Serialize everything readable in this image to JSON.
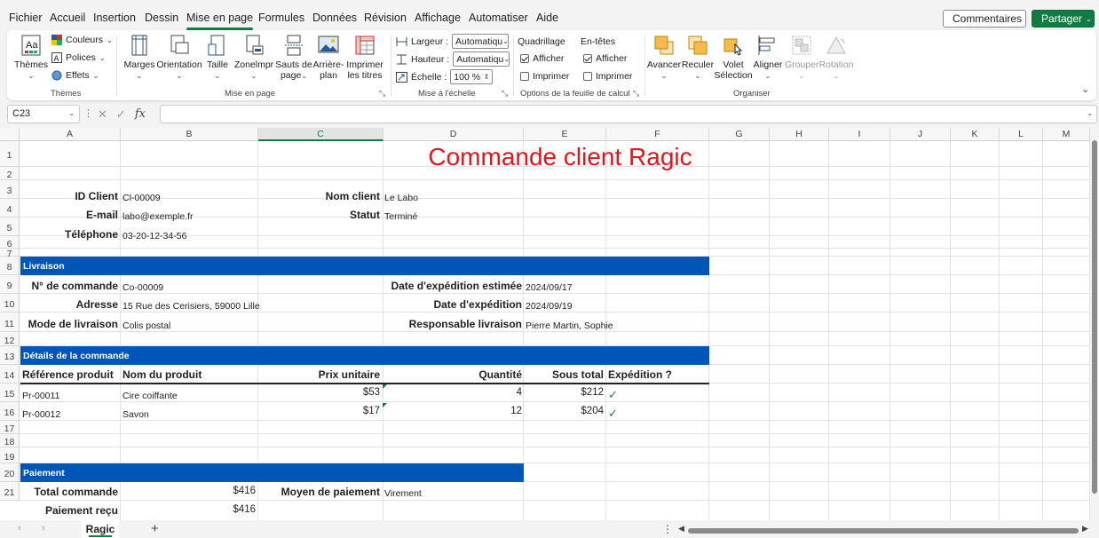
{
  "menu": {
    "tabs": [
      "Fichier",
      "Accueil",
      "Insertion",
      "Dessin",
      "Mise en page",
      "Formules",
      "Données",
      "Révision",
      "Affichage",
      "Automatiser",
      "Aide"
    ],
    "active_tab": "Mise en page",
    "comments_label": "Commentaires",
    "share_label": "Partager"
  },
  "ribbon": {
    "themes": {
      "themes": "Thèmes",
      "colors": "Couleurs",
      "fonts": "Polices",
      "effects": "Effets",
      "group": "Thèmes"
    },
    "page_setup": {
      "margins": "Marges",
      "orientation": "Orientation",
      "size": "Taille",
      "print_area": "Zonelmpr",
      "breaks_1": "Sauts de",
      "breaks_2": "page",
      "background_1": "Arrière-",
      "background_2": "plan",
      "print_titles_1": "Imprimer",
      "print_titles_2": "les titres",
      "group": "Mise en page"
    },
    "scale": {
      "width_label": "Largeur :",
      "width_value": "Automatiqu",
      "height_label": "Hauteur :",
      "height_value": "Automatiqu",
      "scale_label": "Échelle :",
      "scale_value": "100 %",
      "group": "Mise à l'échelle"
    },
    "sheet_options": {
      "gridlines": "Quadrillage",
      "headings": "En-têtes",
      "view": "Afficher",
      "print": "Imprimer",
      "group": "Options de la feuille de calcul"
    },
    "arrange": {
      "forward": "Avancer",
      "backward": "Reculer",
      "pane_1": "Volet",
      "pane_2": "Sélection",
      "align": "Aligner",
      "group_btn": "Grouper",
      "rotate": "Rotation",
      "group": "Organiser"
    }
  },
  "formula_bar": {
    "name_box": "C23",
    "fx": "fx",
    "formula": ""
  },
  "grid": {
    "columns": [
      "A",
      "B",
      "C",
      "D",
      "E",
      "F",
      "G",
      "H",
      "I",
      "J",
      "K",
      "L",
      "M"
    ],
    "selected_column": "C",
    "rows": [
      "1",
      "2",
      "3",
      "4",
      "5",
      "6",
      "7",
      "8",
      "9",
      "10",
      "11",
      "12",
      "13",
      "14",
      "15",
      "16",
      "17",
      "18",
      "19",
      "20",
      "21"
    ]
  },
  "sheet": {
    "title": "Commande client Ragic",
    "client": {
      "id_label": "ID Client",
      "id_value": "Cl-00009",
      "name_label": "Nom client",
      "name_value": "Le Labo",
      "email_label": "E-mail",
      "email_value": "labo@exemple.fr",
      "status_label": "Statut",
      "status_value": "Terminé",
      "phone_label": "Téléphone",
      "phone_value": "03-20-12-34-56"
    },
    "livraison": {
      "header": "Livraison",
      "order_label": "N° de commande",
      "order_value": "Co-00009",
      "est_date_label": "Date d'expédition estimée",
      "est_date_value": "2024/09/17",
      "address_label": "Adresse",
      "address_value": "15 Rue des Cerisiers, 59000 Lille",
      "ship_date_label": "Date d'expédition",
      "ship_date_value": "2024/09/19",
      "mode_label": "Mode de livraison",
      "mode_value": "Colis postal",
      "resp_label": "Responsable livraison",
      "resp_value": "Pierre Martin, Sophie"
    },
    "details": {
      "header": "Détails de la commande",
      "columns": [
        "Référence produit",
        "Nom du produit",
        "Prix unitaire",
        "Quantité",
        "Sous total",
        "Expédition ?"
      ],
      "items": [
        {
          "ref": "Pr-00011",
          "name": "Cire coiffante",
          "price": "$53",
          "qty": "4",
          "subtotal": "$212",
          "shipped": "✓"
        },
        {
          "ref": "Pr-00012",
          "name": "Savon",
          "price": "$17",
          "qty": "12",
          "subtotal": "$204",
          "shipped": "✓"
        }
      ]
    },
    "paiement": {
      "header": "Paiement",
      "total_label": "Total commande",
      "total_value": "$416",
      "method_label": "Moyen de paiement",
      "method_value": "Virement",
      "received_label": "Paiement reçu",
      "received_value": "$416"
    }
  },
  "sheet_tabs": {
    "active": "Ragic",
    "add": "+"
  }
}
